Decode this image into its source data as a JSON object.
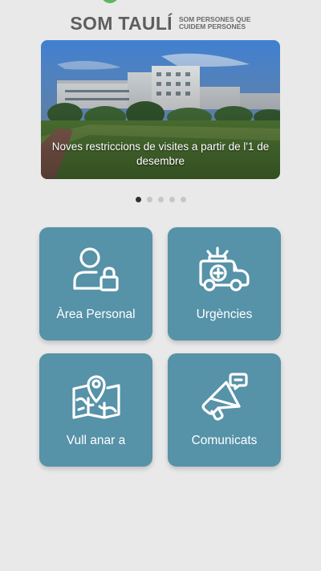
{
  "header": {
    "brand": "SOM TAULÍ",
    "tagline_line1": "SOM PERSONES QUE",
    "tagline_line2": "CUIDEM PERSONES"
  },
  "carousel": {
    "caption": "Noves restriccions de visites a partir de l'1 de desembre",
    "slide_count": 5,
    "active_slide": 1
  },
  "tiles": [
    {
      "label": "Àrea Personal",
      "icon": "person-lock-icon"
    },
    {
      "label": "Urgències",
      "icon": "ambulance-icon"
    },
    {
      "label": "Vull anar a",
      "icon": "map-pin-icon"
    },
    {
      "label": "Comunicats",
      "icon": "megaphone-icon"
    }
  ],
  "colors": {
    "background": "#e9e9e9",
    "tile": "#5692a8",
    "brand_text": "#5e5e5e",
    "active_dot": "#303030",
    "inactive_dot": "#c6c6c6"
  }
}
